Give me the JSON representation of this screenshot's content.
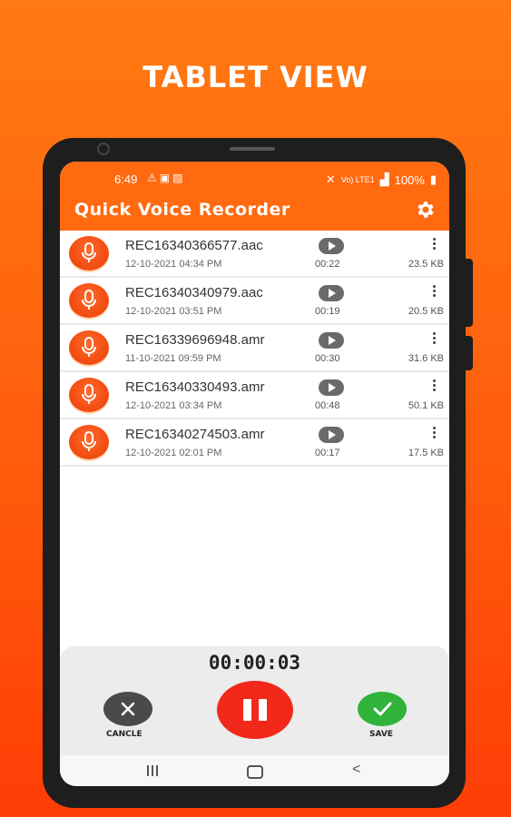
{
  "headline": "TABLET VIEW",
  "status_bar": {
    "time": "6:49",
    "left_icons": [
      "warning-icon",
      "message-icon",
      "image-icon"
    ],
    "right_icons": [
      "mute-icon",
      "signal-icon"
    ],
    "network_label": "Vo) LTE1",
    "battery": "100%"
  },
  "app_bar": {
    "title": "Quick Voice Recorder",
    "settings_icon": "gear-icon"
  },
  "recordings": [
    {
      "name": "REC16340366577.aac",
      "date": "12-10-2021 04:34 PM",
      "duration": "00:22",
      "size": "23.5 KB"
    },
    {
      "name": "REC16340340979.aac",
      "date": "12-10-2021 03:51 PM",
      "duration": "00:19",
      "size": "20.5 KB"
    },
    {
      "name": "REC16339696948.amr",
      "date": "11-10-2021 09:59 PM",
      "duration": "00:30",
      "size": "31.6 KB"
    },
    {
      "name": "REC16340330493.amr",
      "date": "12-10-2021 03:34 PM",
      "duration": "00:48",
      "size": "50.1 KB"
    },
    {
      "name": "REC16340274503.amr",
      "date": "12-10-2021 02:01 PM",
      "duration": "00:17",
      "size": "17.5 KB"
    }
  ],
  "recorder": {
    "timer": "00:00:03",
    "cancel_label": "CANCLE",
    "save_label": "SAVE"
  },
  "colors": {
    "accent": "#ff6a10",
    "pause": "#f2291a",
    "save": "#2fb33a",
    "cancel": "#4a4a4a"
  }
}
